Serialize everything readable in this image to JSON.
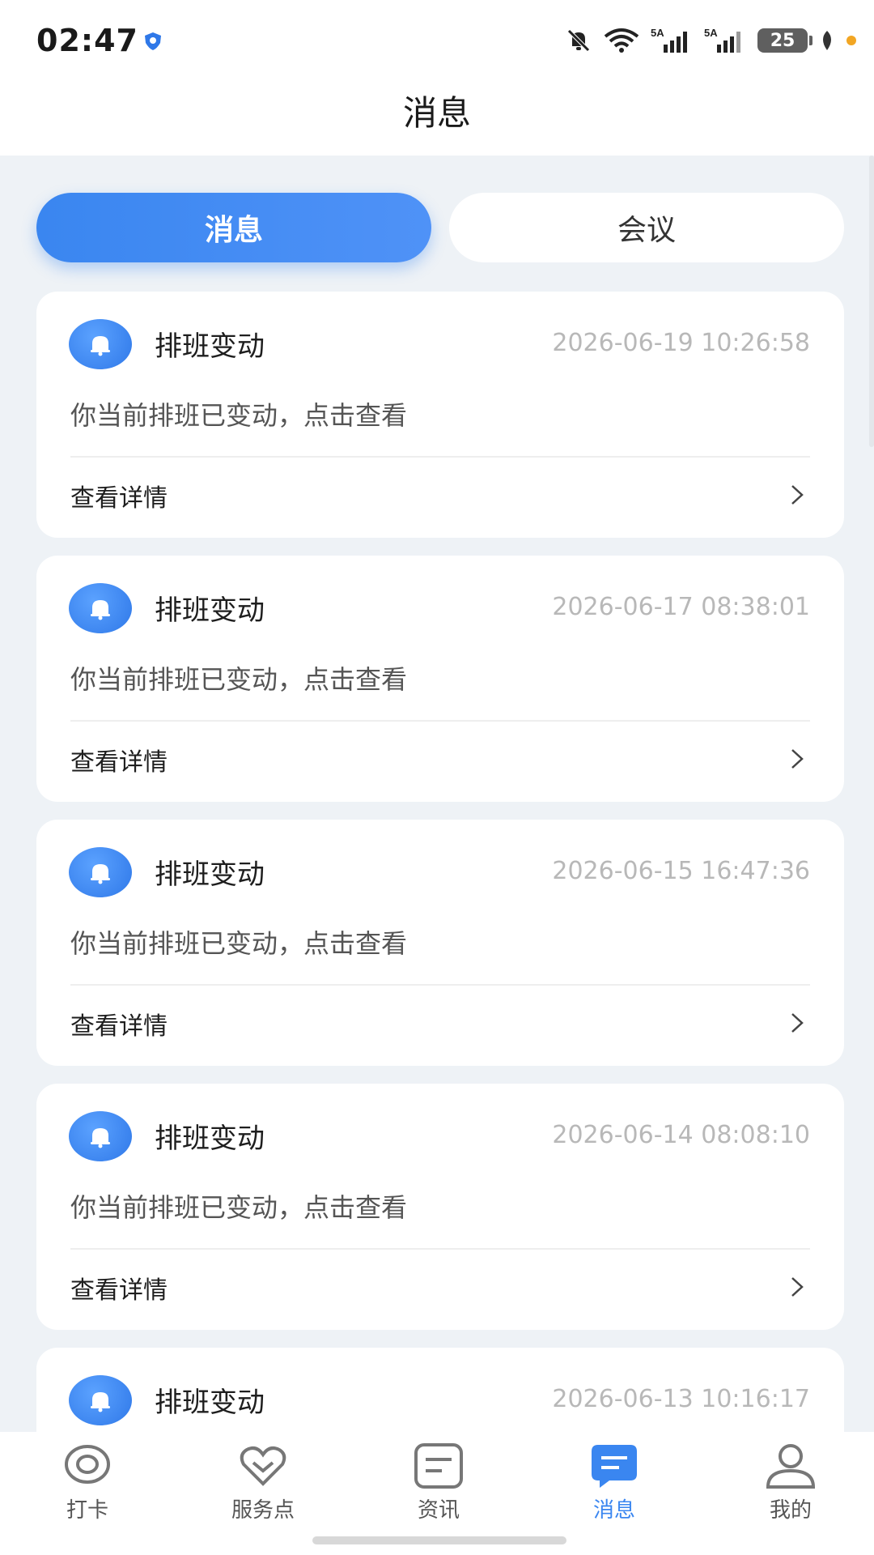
{
  "status_bar": {
    "time": "02:47",
    "battery_level": "25",
    "signal1_label": "5A",
    "signal2_label": "5A",
    "icons": [
      "app-shield-icon",
      "mute-bell-icon",
      "wifi-icon",
      "signal-icon",
      "signal-icon",
      "battery-icon",
      "leaf-icon",
      "notification-dot"
    ]
  },
  "header": {
    "title": "消息"
  },
  "tabs": [
    {
      "label": "消息",
      "active": true
    },
    {
      "label": "会议",
      "active": false
    }
  ],
  "messages": [
    {
      "title": "排班变动",
      "time": "2026-06-19 10:26:58",
      "desc": "你当前排班已变动，点击查看",
      "link": "查看详情"
    },
    {
      "title": "排班变动",
      "time": "2026-06-17 08:38:01",
      "desc": "你当前排班已变动，点击查看",
      "link": "查看详情"
    },
    {
      "title": "排班变动",
      "time": "2026-06-15 16:47:36",
      "desc": "你当前排班已变动，点击查看",
      "link": "查看详情"
    },
    {
      "title": "排班变动",
      "time": "2026-06-14 08:08:10",
      "desc": "你当前排班已变动，点击查看",
      "link": "查看详情"
    },
    {
      "title": "排班变动",
      "time": "2026-06-13 10:16:17"
    }
  ],
  "bottom_nav": [
    {
      "label": "打卡",
      "icon": "location-pin-icon",
      "active": false
    },
    {
      "label": "服务点",
      "icon": "heart-icon",
      "active": false
    },
    {
      "label": "资讯",
      "icon": "news-icon",
      "active": false
    },
    {
      "label": "消息",
      "icon": "chat-bubble-icon",
      "active": true
    },
    {
      "label": "我的",
      "icon": "person-icon",
      "active": false
    }
  ],
  "colors": {
    "accent": "#3a86f0",
    "background": "#eef2f6",
    "muted_text": "#b8b8b8"
  }
}
